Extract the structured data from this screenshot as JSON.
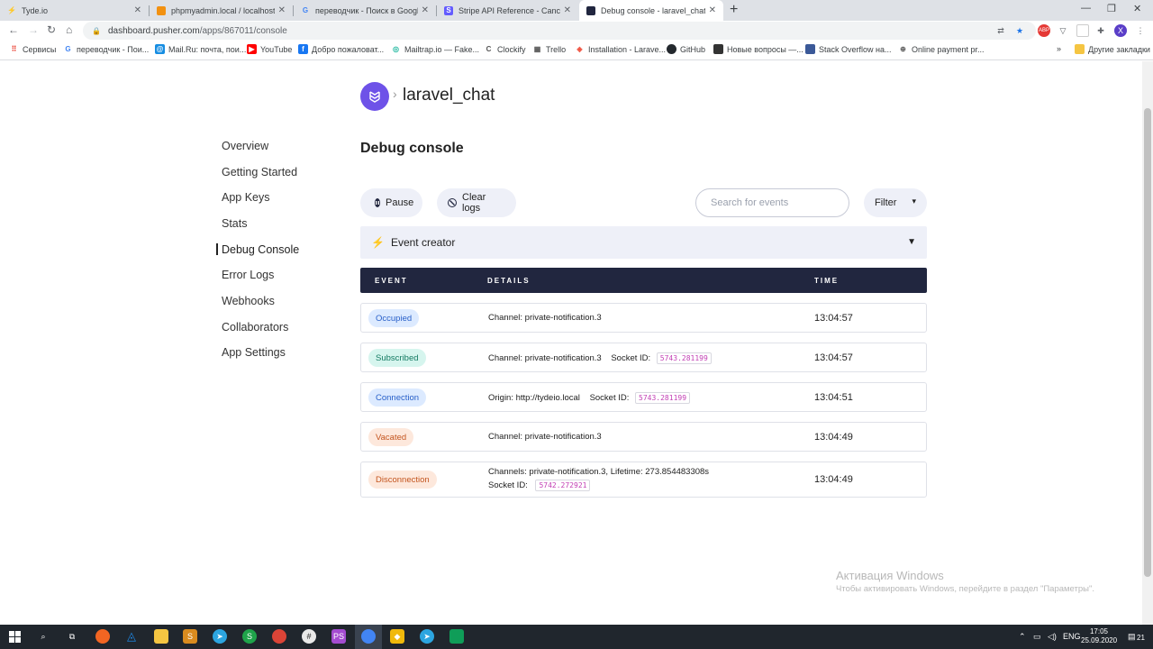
{
  "browser": {
    "tabs": [
      {
        "title": "Tyde.io",
        "active": false
      },
      {
        "title": "phpmyadmin.local / localhost / ty",
        "active": false
      },
      {
        "title": "переводчик - Поиск в Google",
        "active": false
      },
      {
        "title": "Stripe API Reference - Cancel a s",
        "active": false
      },
      {
        "title": "Debug console - laravel_chat - C",
        "active": true
      }
    ],
    "url_host": "dashboard.pusher.com",
    "url_path": "/apps/867011/console",
    "bookmarks": [
      "Сервисы",
      "переводчик - Пои...",
      "Mail.Ru: почта, пои...",
      "YouTube",
      "Добро пожаловат...",
      "Mailtrap.io — Fake...",
      "Clockify",
      "Trello",
      "Installation - Larave...",
      "GitHub",
      "Новые вопросы —...",
      "Stack Overflow на...",
      "Online payment pr...",
      "Другие закладки"
    ],
    "profile_initial": "X"
  },
  "app": {
    "name": "laravel_chat",
    "page_title": "Debug console"
  },
  "nav": [
    {
      "label": "Overview"
    },
    {
      "label": "Getting Started"
    },
    {
      "label": "App Keys"
    },
    {
      "label": "Stats"
    },
    {
      "label": "Debug Console",
      "active": true
    },
    {
      "label": "Error Logs"
    },
    {
      "label": "Webhooks"
    },
    {
      "label": "Collaborators"
    },
    {
      "label": "App Settings"
    }
  ],
  "controls": {
    "pause_label": "Pause",
    "clear_label": "Clear logs",
    "search_placeholder": "Search for events",
    "filter_label": "Filter"
  },
  "event_creator": {
    "label": "Event creator"
  },
  "table": {
    "headers": {
      "event": "EVENT",
      "details": "DETAILS",
      "time": "TIME"
    },
    "rows": [
      {
        "event": "Occupied",
        "details": "Channel: private-notification.3",
        "socket_label": "",
        "socket_id": "",
        "time": "13:04:57",
        "badge_bg": "#dceaff",
        "badge_fg": "#2960c9"
      },
      {
        "event": "Subscribed",
        "details": "Channel: private-notification.3",
        "socket_label": "Socket ID:",
        "socket_id": "5743.281199",
        "time": "13:04:57",
        "badge_bg": "#d6f5ee",
        "badge_fg": "#137a62"
      },
      {
        "event": "Connection",
        "details": "Origin: http://tydeio.local",
        "socket_label": "Socket ID:",
        "socket_id": "5743.281199",
        "time": "13:04:51",
        "badge_bg": "#dceaff",
        "badge_fg": "#2960c9"
      },
      {
        "event": "Vacated",
        "details": "Channel: private-notification.3",
        "socket_label": "",
        "socket_id": "",
        "time": "13:04:49",
        "badge_bg": "#fde8dc",
        "badge_fg": "#c4551f"
      },
      {
        "event": "Disconnection",
        "details": "Channels: private-notification.3, Lifetime: 273.854483308s",
        "socket_label": "Socket ID:",
        "socket_id": "5742.272921",
        "time": "13:04:49",
        "badge_bg": "#fde8dc",
        "badge_fg": "#c4551f"
      }
    ]
  },
  "watermark": {
    "line1": "Активация Windows",
    "line2": "Чтобы активировать Windows, перейдите в раздел \"Параметры\"."
  },
  "taskbar": {
    "lang": "ENG",
    "time": "17:05",
    "date": "25.09.2020",
    "notif_count": "21"
  },
  "colors": {
    "pusher_purple": "#6e52e8",
    "table_header": "#21263f",
    "control_bg": "#eef0f8",
    "socket_id": "#c23fb4"
  }
}
